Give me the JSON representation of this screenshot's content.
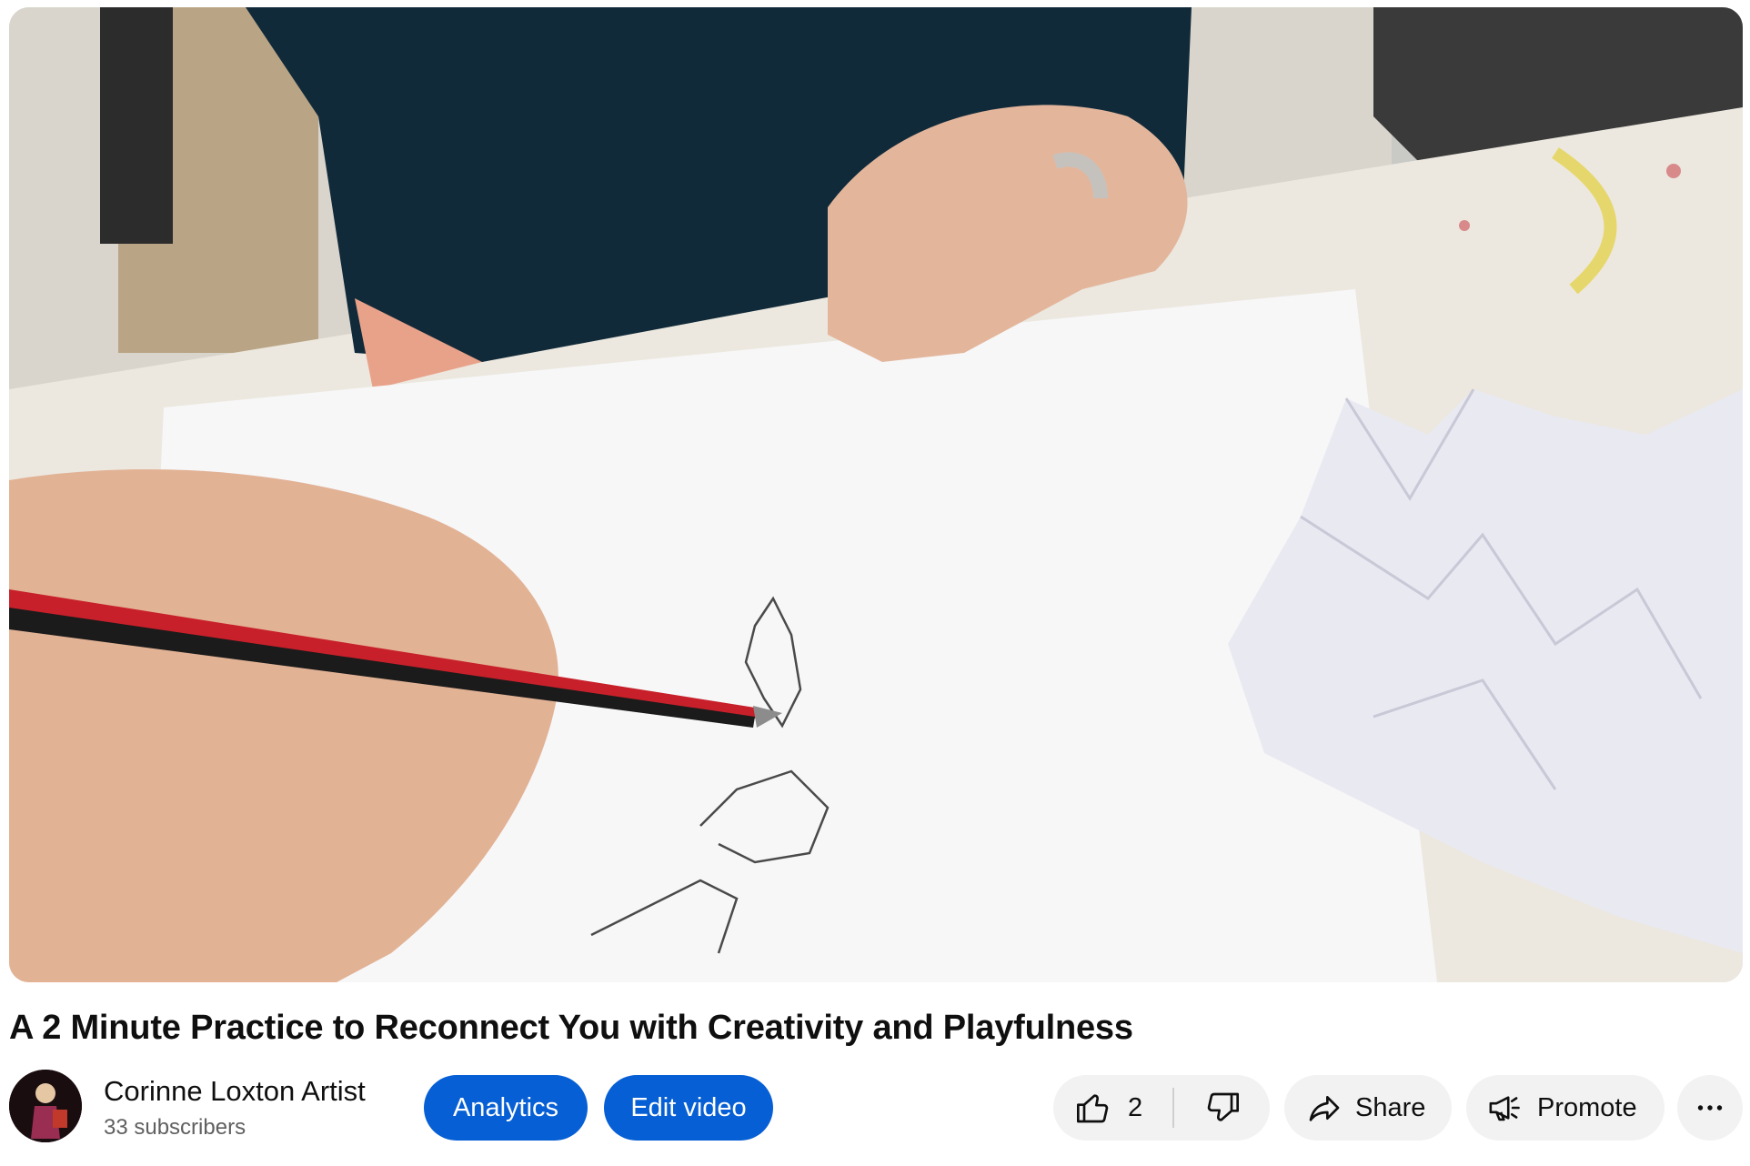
{
  "video": {
    "title": "A 2 Minute Practice to Reconnect You with Creativity and Playfulness"
  },
  "channel": {
    "name": "Corinne Loxton Artist",
    "subscribers": "33 subscribers"
  },
  "actions": {
    "analytics_label": "Analytics",
    "edit_label": "Edit video",
    "like_count": "2",
    "share_label": "Share",
    "promote_label": "Promote"
  },
  "colors": {
    "primary_button": "#065fd4",
    "secondary_button": "#f2f2f2"
  },
  "icons": [
    "thumbs-up-icon",
    "thumbs-down-icon",
    "share-arrow-icon",
    "megaphone-icon",
    "more-horizontal-icon"
  ]
}
